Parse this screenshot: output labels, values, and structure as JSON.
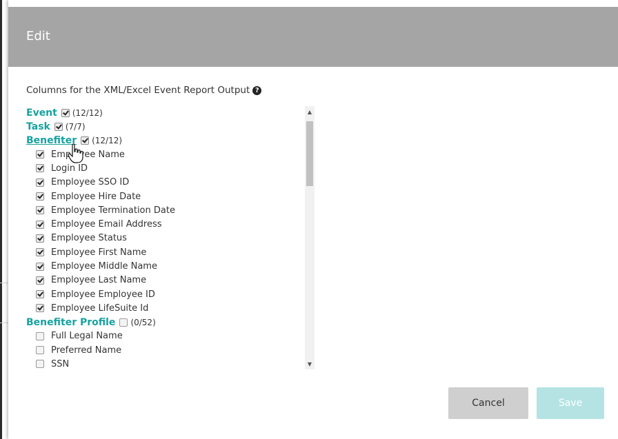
{
  "modal": {
    "title": "Edit",
    "section_label": "Columns for the XML/Excel Event Report Output",
    "help_icon": "question-circle-icon"
  },
  "groups": [
    {
      "title": "Event",
      "count": "(12/12)",
      "checked": true,
      "link": false,
      "items": []
    },
    {
      "title": "Task",
      "count": "(7/7)",
      "checked": true,
      "link": false,
      "items": []
    },
    {
      "title": "Benefiter",
      "count": "(12/12)",
      "checked": true,
      "link": true,
      "items": [
        {
          "label": "Employee Name",
          "checked": true
        },
        {
          "label": "Login ID",
          "checked": true
        },
        {
          "label": "Employee SSO ID",
          "checked": true
        },
        {
          "label": "Employee Hire Date",
          "checked": true
        },
        {
          "label": "Employee Termination Date",
          "checked": true
        },
        {
          "label": "Employee Email Address",
          "checked": true
        },
        {
          "label": "Employee Status",
          "checked": true
        },
        {
          "label": "Employee First Name",
          "checked": true
        },
        {
          "label": "Employee Middle Name",
          "checked": true
        },
        {
          "label": "Employee Last Name",
          "checked": true
        },
        {
          "label": "Employee Employee ID",
          "checked": true
        },
        {
          "label": "Employee LifeSuite Id",
          "checked": true
        }
      ]
    },
    {
      "title": "Benefiter Profile",
      "count": "(0/52)",
      "checked": false,
      "link": false,
      "items": [
        {
          "label": "Full Legal Name",
          "checked": false
        },
        {
          "label": "Preferred Name",
          "checked": false
        },
        {
          "label": "SSN",
          "checked": false
        }
      ]
    }
  ],
  "buttons": {
    "cancel_label": "Cancel",
    "save_label": "Save"
  },
  "colors": {
    "header_bg": "#a5a5a5",
    "accent": "#17a2a0",
    "save_disabled": "#b5e3e3",
    "cancel_bg": "#cfcfcf"
  }
}
